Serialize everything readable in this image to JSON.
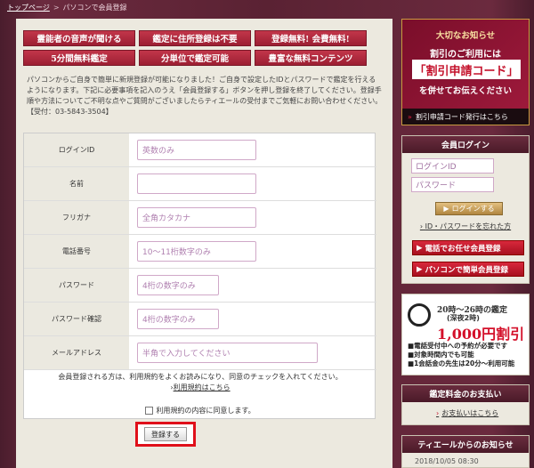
{
  "breadcrumb": {
    "home": "トップページ",
    "separator": ">",
    "current": "パソコンで会員登録"
  },
  "features": [
    "霊能者の音声が聞ける",
    "鑑定に住所登録は不要",
    "登録無料! 会費無料!",
    "5分間無料鑑定",
    "分単位で鑑定可能",
    "豊富な無料コンテンツ"
  ],
  "intro": {
    "text": "パソコンからご自身で簡単に新規登録が可能になりました！ご自身で設定したIDとパスワードで鑑定を行えるようになります。下記に必要事項を記入のうえ「会員登録する」ボタンを押し登録を終了してください。登録手順や方法についてご不明な点やご質問がございましたらティエールの受付までご気軽にお問い合わせください。",
    "phone": "【受付：03-5843-3504】"
  },
  "form": {
    "fields": [
      {
        "label": "ログインID",
        "placeholder": "英数のみ"
      },
      {
        "label": "名前",
        "placeholder": ""
      },
      {
        "label": "フリガナ",
        "placeholder": "全角カタカナ"
      },
      {
        "label": "電話番号",
        "placeholder": "10～11桁数字のみ"
      },
      {
        "label": "パスワード",
        "placeholder": "4桁の数字のみ"
      },
      {
        "label": "パスワード確認",
        "placeholder": "4桁の数字のみ"
      },
      {
        "label": "メールアドレス",
        "placeholder": "半角で入力してください"
      }
    ],
    "terms_text": "会員登録される方は、利用規約をよくお読みになり、同意のチェックを入れてください。",
    "terms_link": "利用規約はこちら",
    "terms_link_prefix": "›",
    "agree_label": "利用規約の内容に同意します。",
    "submit_label": "登録する"
  },
  "promo": {
    "line1": "大切なお知らせ",
    "line2": "割引のご利用には",
    "code": "「割引申請コード」",
    "line3": "を併せてお伝えください",
    "link": "割引申請コード発行はこちら",
    "link_arrow": "»"
  },
  "login": {
    "title": "会員ログイン",
    "id_placeholder": "ログインID",
    "pw_placeholder": "パスワード",
    "button": "ログインする",
    "button_arrow": "▶",
    "forgot": "ID・パスワードを忘れた方",
    "forgot_arrow": "›",
    "phone_register": "電話でお任せ会員登録",
    "pc_register": "パソコンで簡単会員登録",
    "register_arrow": "▶"
  },
  "discount": {
    "hours": "20時～26時の鑑定",
    "until": "(深夜2時)",
    "amount": "1,000円割引",
    "notes": [
      "■電話受付中への予約が必要です",
      "■対象時間内でも可能",
      "■1会話金の先生は20分～利用可能"
    ]
  },
  "fee": {
    "title": "鑑定料金のお支払い",
    "link": "お支払いはこちら",
    "link_arrow": "›"
  },
  "news": {
    "title": "ティエールからのお知らせ",
    "date": "2018/10/05 08:30"
  }
}
